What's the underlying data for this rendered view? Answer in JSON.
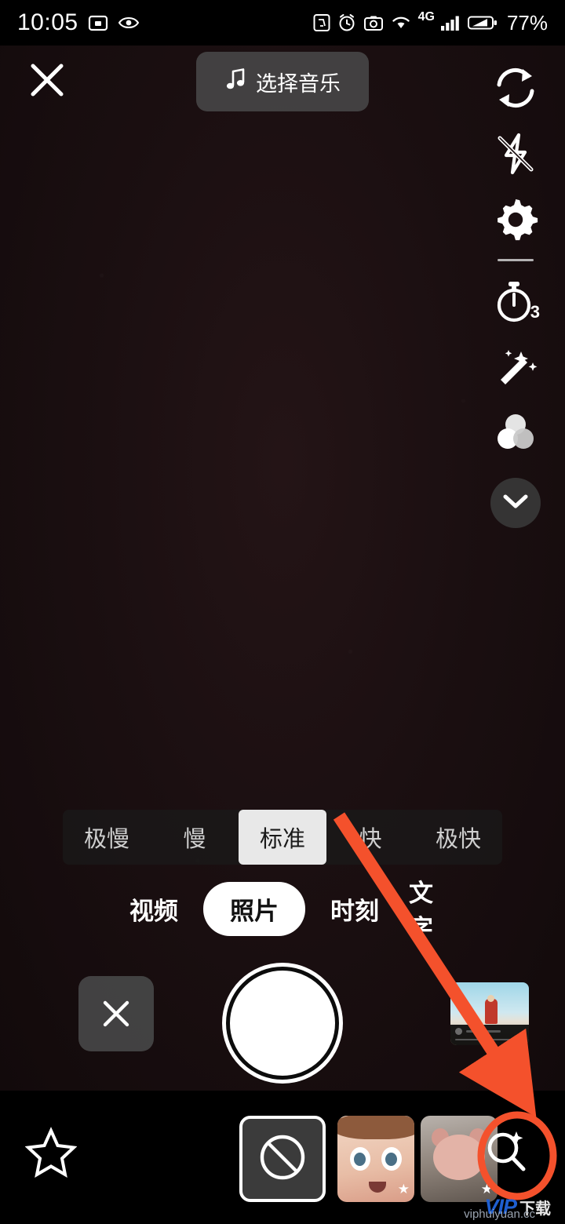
{
  "status_bar": {
    "time": "10:05",
    "battery_percent": "77%",
    "network_label": "4G",
    "icons": [
      "screen-record-icon",
      "eye-icon",
      "nfc-icon",
      "alarm-icon",
      "camera-mute-icon",
      "wifi-icon",
      "signal-icon",
      "battery-icon"
    ]
  },
  "top_bar": {
    "close_label": "×",
    "music_label": "选择音乐",
    "music_icon": "music-note-icon"
  },
  "right_rail": {
    "items": [
      {
        "name": "flip-camera-icon",
        "label": "翻转"
      },
      {
        "name": "flash-off-icon",
        "label": "闪光灯关闭"
      },
      {
        "name": "settings-gear-icon",
        "label": "设置"
      },
      {
        "name": "timer-icon",
        "label": "倒计时",
        "badge": "3"
      },
      {
        "name": "beauty-wand-icon",
        "label": "美化"
      },
      {
        "name": "filter-icon",
        "label": "滤镜"
      }
    ],
    "collapse_icon": "chevron-down-icon"
  },
  "speed_bar": {
    "options": [
      "极慢",
      "慢",
      "标准",
      "快",
      "极快"
    ],
    "selected": "标准"
  },
  "modes": {
    "items": [
      "视频",
      "照片",
      "时刻",
      "文字"
    ],
    "selected": "照片"
  },
  "capture_row": {
    "cancel_icon": "close-icon",
    "shutter_label": "拍摄按钮",
    "gallery_label": "相册缩略图"
  },
  "effects_bar": {
    "favorite_icon": "star-outline-icon",
    "items": [
      {
        "name": "effect-none",
        "label": "无特效",
        "icon": "no-effect-icon"
      },
      {
        "name": "effect-doll-face",
        "label": "大眼特效"
      },
      {
        "name": "effect-pig",
        "label": "小猪特效"
      }
    ],
    "search_icon": "search-sparkle-icon"
  },
  "annotation": {
    "arrow_color": "#f4512c",
    "circle_color": "#f4512c",
    "target": "search-sparkle-icon"
  },
  "watermark": {
    "brand": "VIP",
    "suffix": "下载",
    "url": "viphuiyuan.cc"
  }
}
